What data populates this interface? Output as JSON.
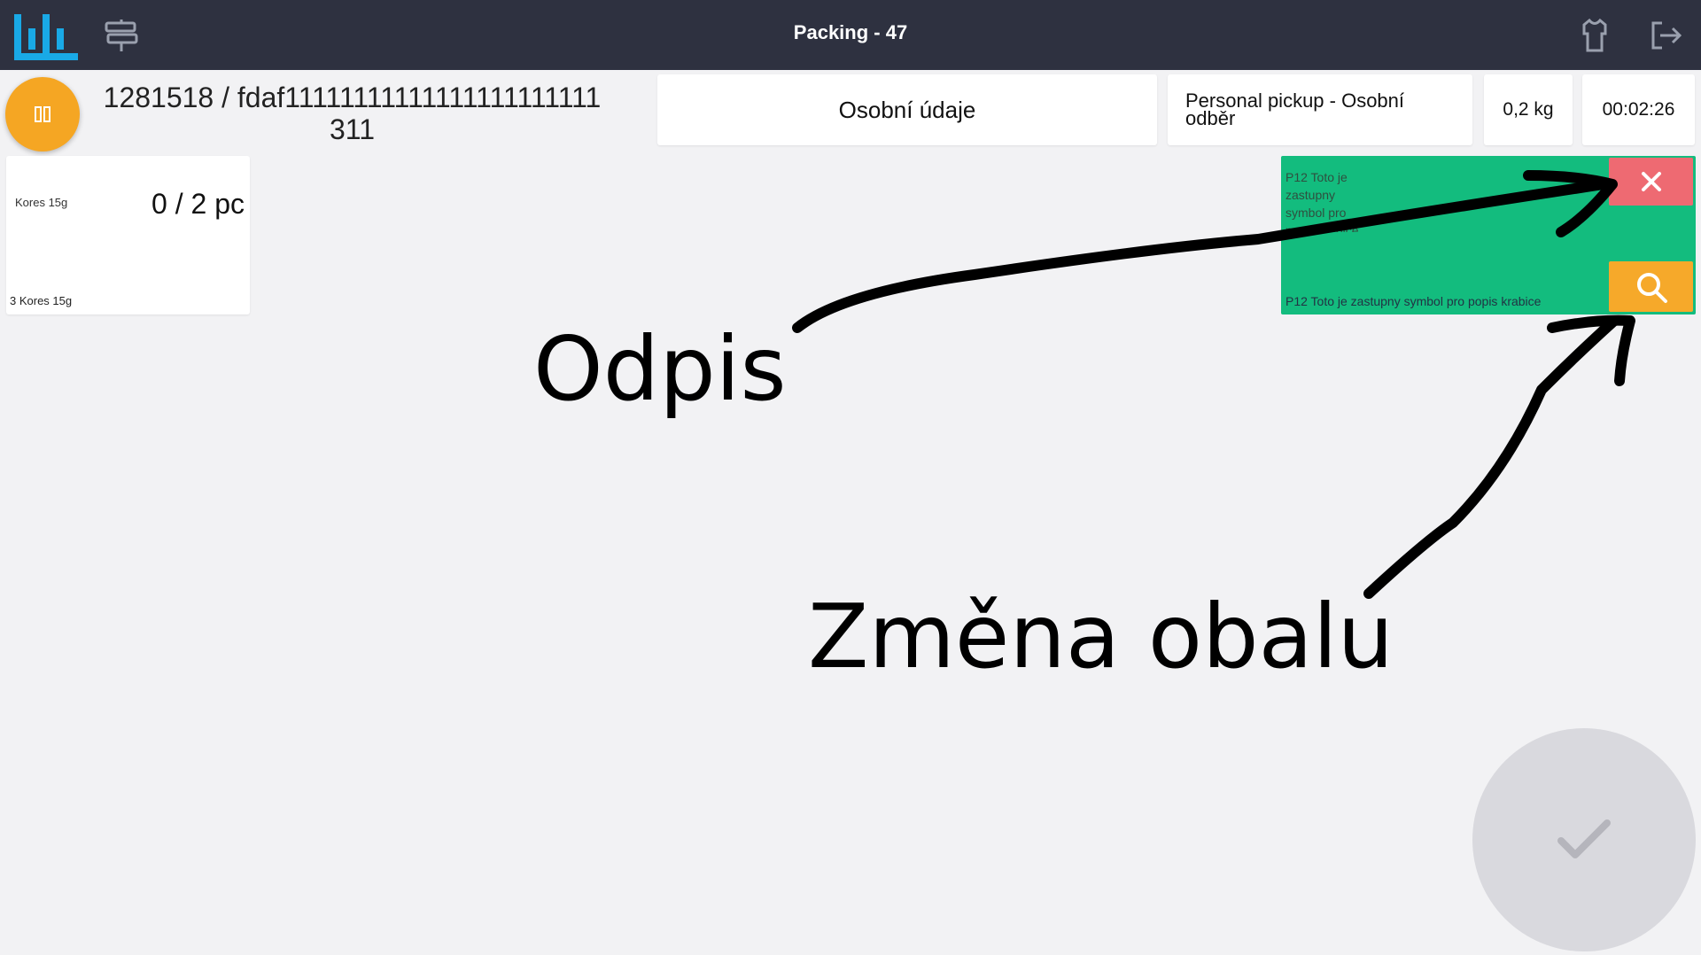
{
  "header": {
    "title": "Packing - 47"
  },
  "order": {
    "id": "1281518 / fdaf11111111111111111111111311",
    "personal_data_label": "Osobní údaje",
    "delivery": "Personal pickup - Osobní odběr",
    "weight": "0,2 kg",
    "timer": "00:02:26"
  },
  "product": {
    "image_alt": "Kores 15g",
    "quantity": "0 / 2 pc",
    "name": "3 Kores 15g"
  },
  "package": {
    "image_alt": "P12 Toto je zastupny symbol pro popis krabice",
    "name": "P12 Toto je zastupny symbol pro popis krabice"
  },
  "annotations": {
    "remove_label": "Odpis",
    "change_label": "Změna obalu"
  },
  "colors": {
    "topbar": "#2e3140",
    "accent_orange": "#f5a623",
    "package_green": "#13bc7e",
    "remove_red": "#ee6a72",
    "logo_blue": "#19a9e6"
  }
}
